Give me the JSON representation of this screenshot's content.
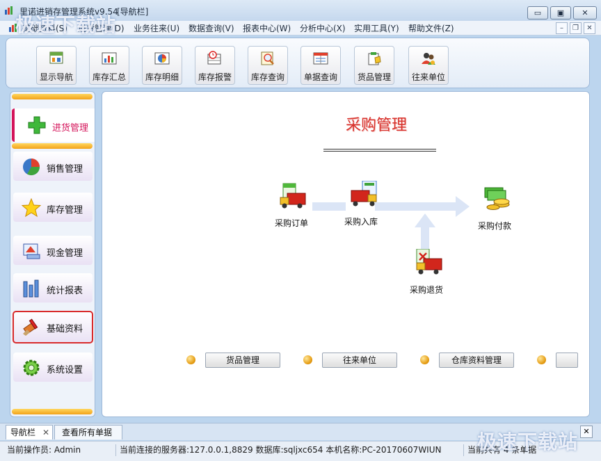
{
  "window": {
    "title": "里诺进销存管理系统v9.54",
    "title_suffix": "[导航栏]",
    "controls": [
      "▭",
      "▣",
      "✕"
    ]
  },
  "menubar": {
    "items": [
      "基础资料(S)",
      "进货管理(D)",
      "业务往来(U)",
      "数据查询(V)",
      "报表中心(W)",
      "分析中心(X)",
      "实用工具(Y)",
      "帮助文件(Z)"
    ],
    "mdi_controls": [
      "–",
      "❐",
      "✕"
    ]
  },
  "toolbar": {
    "buttons": [
      {
        "label": "显示导航",
        "icon": "navigation-icon"
      },
      {
        "label": "库存汇总",
        "icon": "inventory-summary-icon"
      },
      {
        "label": "库存明细",
        "icon": "inventory-detail-icon"
      },
      {
        "label": "库存报警",
        "icon": "inventory-alarm-icon"
      },
      {
        "label": "库存查询",
        "icon": "inventory-query-icon"
      },
      {
        "label": "单据查询",
        "icon": "document-query-icon"
      },
      {
        "label": "货品管理",
        "icon": "goods-icon"
      },
      {
        "label": "往来单位",
        "icon": "contacts-icon"
      }
    ]
  },
  "sidebar": {
    "items": [
      {
        "label": "进货管理",
        "icon": "plus-icon",
        "active": true
      },
      {
        "label": "销售管理",
        "icon": "pie-chart-icon"
      },
      {
        "label": "库存管理",
        "icon": "star-icon"
      },
      {
        "label": "现金管理",
        "icon": "cash-icon"
      },
      {
        "label": "统计报表",
        "icon": "bar-chart-icon"
      },
      {
        "label": "基础资料",
        "icon": "brush-icon",
        "highlighted": true
      },
      {
        "label": "系统设置",
        "icon": "gear-icon"
      }
    ]
  },
  "main": {
    "title": "采购管理",
    "flow": [
      {
        "label": "采购订单",
        "icon": "order-truck-icon"
      },
      {
        "label": "采购入库",
        "icon": "stock-in-truck-icon"
      },
      {
        "label": "采购付款",
        "icon": "payment-icon"
      },
      {
        "label": "采购退货",
        "icon": "return-truck-icon"
      }
    ],
    "quick_links": [
      "货品管理",
      "往来单位",
      "仓库资料管理",
      ""
    ]
  },
  "tabs": [
    {
      "label": "导航栏",
      "closable": true
    },
    {
      "label": "查看所有单据",
      "closable": false
    }
  ],
  "tabs_close": "✕",
  "status": {
    "operator": "当前操作员: Admin",
    "connection": "当前连接的服务器:127.0.0.1,8829 数据库:sqljxc654 本机名称:PC-20170607WIUN",
    "count": "当前共有 4 条单据"
  },
  "watermark": "极速下载站",
  "colors": {
    "accent": "#d4145a",
    "title_red": "#d8322c",
    "orange": "#f2a21a",
    "panel_border": "#9db8d8"
  }
}
